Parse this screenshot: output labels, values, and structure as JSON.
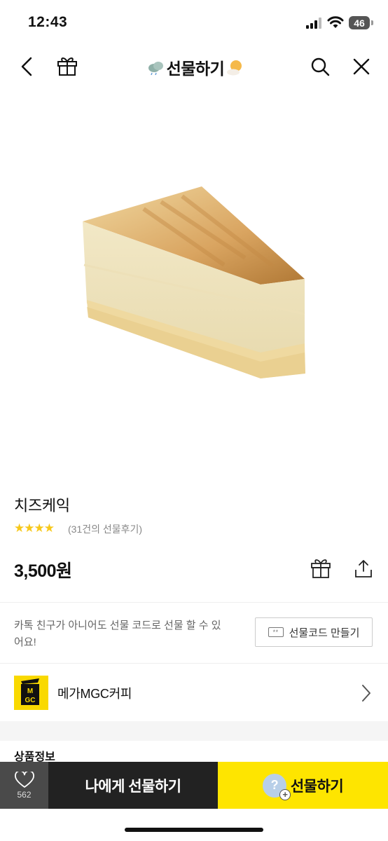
{
  "status_bar": {
    "time": "12:43",
    "battery": "46"
  },
  "nav": {
    "title": "선물하기"
  },
  "product": {
    "name": "치즈케익",
    "stars": "★★★★",
    "review_text": "(31건의 선물후기)",
    "price": "3,500원"
  },
  "gift_code": {
    "description": "카톡 친구가 아니어도 선물 코드로 선물 할 수 있어요!",
    "icon_text": "**",
    "button_label": "선물코드 만들기"
  },
  "brand": {
    "logo_text": "MGC",
    "name": "메가MGC커피"
  },
  "section": {
    "title": "상품정보"
  },
  "bottom_bar": {
    "like_count": "562",
    "self_gift_label": "나에게 선물하기",
    "avatar_text": "?",
    "gift_label": "선물하기"
  },
  "colors": {
    "accent": "#fee500",
    "star": "#f7c81a"
  }
}
